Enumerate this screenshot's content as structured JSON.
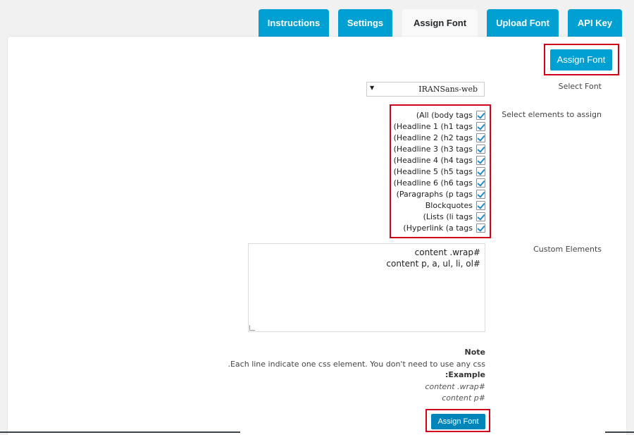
{
  "tabs": [
    {
      "label": "Instructions"
    },
    {
      "label": "Settings"
    },
    {
      "label": "Assign Font"
    },
    {
      "label": "Upload Font"
    },
    {
      "label": "API Key"
    }
  ],
  "top_button": {
    "label": "Assign Font"
  },
  "select_font": {
    "label": "Select Font",
    "value": "IRANSans-web"
  },
  "elements": {
    "label": "Select elements to assign",
    "items": [
      {
        "label": "(All (body tags",
        "checked": true
      },
      {
        "label": "(Headline 1 (h1 tags",
        "checked": true
      },
      {
        "label": "(Headline 2 (h2 tags",
        "checked": true
      },
      {
        "label": "(Headline 3 (h3 tags",
        "checked": true
      },
      {
        "label": "(Headline 4 (h4 tags",
        "checked": true
      },
      {
        "label": "(Headline 5 (h5 tags",
        "checked": true
      },
      {
        "label": "(Headline 6 (h6 tags",
        "checked": true
      },
      {
        "label": "(Paragraphs (p tags",
        "checked": true
      },
      {
        "label": "Blockquotes",
        "checked": true
      },
      {
        "label": "(Lists (li tags",
        "checked": true
      },
      {
        "label": "(Hyperlink (a tags",
        "checked": true
      }
    ]
  },
  "custom_elements": {
    "label": "Custom Elements",
    "lines": [
      "content .wrap#",
      "content p, a, ul, li, ol#"
    ]
  },
  "note": {
    "title": "Note",
    "text": ".Each line indicate one css element. You don't need to use any css",
    "example_title": ":Example",
    "example_lines": [
      "content .wrap#",
      "content p#"
    ]
  },
  "bottom_button": {
    "label": "Assign Font"
  },
  "colors": {
    "accent": "#00a0d2",
    "highlight": "#d0021b",
    "check": "#1e8cbe"
  }
}
